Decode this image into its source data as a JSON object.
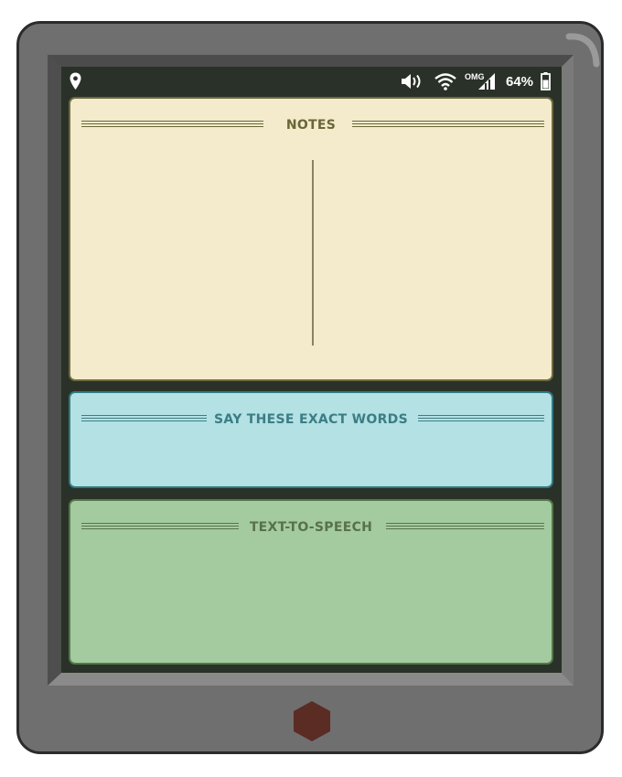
{
  "status_bar": {
    "network_label": "OMG",
    "battery_percent": "64%",
    "icons": [
      "location-pin-icon",
      "volume-icon",
      "wifi-icon",
      "signal-icon",
      "battery-icon"
    ]
  },
  "panels": {
    "notes": {
      "title": "NOTES"
    },
    "say": {
      "title": "SAY THESE EXACT WORDS"
    },
    "tts": {
      "title": "TEXT-TO-SPEECH"
    }
  },
  "colors": {
    "device_body": "#6f6f6f",
    "screen": "#2a3128",
    "notes_bg": "#f3ebcc",
    "say_bg": "#b3e1e4",
    "tts_bg": "#a3cb9f",
    "home_button": "#5a2c24"
  },
  "battery_level": 0.64
}
